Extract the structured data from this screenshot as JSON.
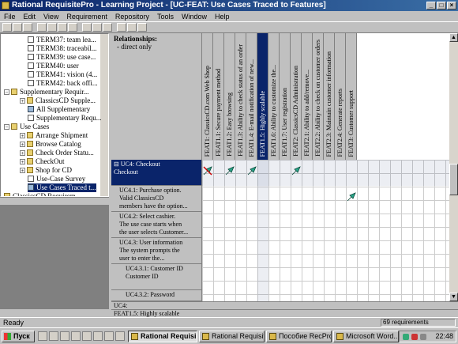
{
  "window": {
    "title": "Rational RequisitePro - Learning Project - [UC-FEAT: Use Cases Traced to Features]",
    "controls": [
      "_",
      "□",
      "×"
    ]
  },
  "menu": [
    "File",
    "Edit",
    "View",
    "Requirement",
    "Repository",
    "Tools",
    "Window",
    "Help"
  ],
  "toolbar": {
    "buttons": [
      "new-icon",
      "open-icon",
      "save-icon",
      "print-icon",
      "cut-icon",
      "copy-icon",
      "paste-icon",
      "undo-icon",
      "properties-icon",
      "query-icon",
      "trace-icon",
      "filter-icon",
      "help-icon"
    ]
  },
  "tree": {
    "items": [
      {
        "label": "TERM37: team lea...",
        "icon": "doc",
        "indent": 34,
        "expander": ""
      },
      {
        "label": "TERM38: traceabil...",
        "icon": "doc",
        "indent": 34,
        "expander": ""
      },
      {
        "label": "TERM39: use case...",
        "icon": "doc",
        "indent": 34,
        "expander": ""
      },
      {
        "label": "TERM40: user",
        "icon": "doc",
        "indent": 34,
        "expander": ""
      },
      {
        "label": "TERM41: vision (4...",
        "icon": "doc",
        "indent": 34,
        "expander": ""
      },
      {
        "label": "TERM42: back offi...",
        "icon": "doc",
        "indent": 34,
        "expander": ""
      },
      {
        "label": "Supplementary Requir...",
        "icon": "folder",
        "indent": 4,
        "expander": "−"
      },
      {
        "label": "ClassicsCD Supple...",
        "icon": "folder",
        "indent": 24,
        "expander": "+"
      },
      {
        "label": "All Supplementary",
        "icon": "pkg",
        "indent": 34,
        "expander": ""
      },
      {
        "label": "Supplementary Requ...",
        "icon": "doc",
        "indent": 34,
        "expander": ""
      },
      {
        "label": "Use Cases",
        "icon": "folder",
        "indent": 4,
        "expander": "−"
      },
      {
        "label": "Arrange Shipment",
        "icon": "folder",
        "indent": 24,
        "expander": "+"
      },
      {
        "label": "Browse Catalog",
        "icon": "folder",
        "indent": 24,
        "expander": "+"
      },
      {
        "label": "Check Order Statu...",
        "icon": "folder",
        "indent": 24,
        "expander": "+"
      },
      {
        "label": "CheckOut",
        "icon": "folder",
        "indent": 24,
        "expander": "+"
      },
      {
        "label": "Shop for CD",
        "icon": "folder",
        "indent": 24,
        "expander": "+"
      },
      {
        "label": "Use-Case Survey",
        "icon": "doc",
        "indent": 34,
        "expander": ""
      },
      {
        "label": "Use Cases Traced t...",
        "icon": "pkg",
        "indent": 34,
        "expander": "",
        "selected": true
      },
      {
        "label": "ClassicsCD Requirem...",
        "icon": "folder",
        "indent": 4,
        "expander": ""
      }
    ]
  },
  "matrix": {
    "corner_title": "Relationships:",
    "corner_sub": "- direct only",
    "columns": [
      {
        "label": "FEAT1: ClassicsCD.com Web Shop"
      },
      {
        "label": "FEAT1.1: Secure payment method"
      },
      {
        "label": "FEAT1.2: Easy browsing"
      },
      {
        "label": "FEAT1.3: Ability to check status of an order"
      },
      {
        "label": "FEAT1.4: E-mail notification of new..."
      },
      {
        "label": "FEAT1.5: Highly scalable",
        "selected": true
      },
      {
        "label": "FEAT1.6: Ability to customize the..."
      },
      {
        "label": "FEAT1.7: User registration"
      },
      {
        "label": "FEAT2: ClassicsCD Administration"
      },
      {
        "label": "FEAT2.1: Ability to add/remove..."
      },
      {
        "label": "FEAT2.2: Ability to check on customer orders"
      },
      {
        "label": "FEAT2.3: Maintain customer information"
      },
      {
        "label": "FEAT2.4: Generate reports"
      },
      {
        "label": "FEAT3: Customer support"
      }
    ],
    "rows": [
      {
        "label": "⊟ UC4: Checkout\nCheckout",
        "height": 33,
        "selected": true
      },
      {
        "label": "UC4.1: Purchase option.\nValid ClassicsCD\nmembers have the option...",
        "height": 33
      },
      {
        "label": "UC4.2: Select cashier.\nThe use case starts when\nthe user selects Customer...",
        "height": 33
      },
      {
        "label": "UC4.3: User information\nThe system prompts the\nuser to enter the...",
        "height": 33
      },
      {
        "label": "UC4.3.1: Customer ID\nCustomer ID",
        "height": 33
      },
      {
        "label": "UC4.3.2: Password",
        "height": 14
      }
    ],
    "traces": [
      {
        "row": 0,
        "col": 0,
        "type": "suspect"
      },
      {
        "row": 0,
        "col": 2,
        "type": "trace"
      },
      {
        "row": 0,
        "col": 4,
        "type": "trace"
      },
      {
        "row": 0,
        "col": 8,
        "type": "trace"
      },
      {
        "row": 1,
        "col": 13,
        "type": "trace"
      }
    ],
    "current_row_label": "UC4:",
    "current_row_text": "FEAT1.5: Highly scalable"
  },
  "status": {
    "ready": "Ready",
    "count": "69 requirements"
  },
  "taskbar": {
    "start": "Пуск",
    "tasks": [
      {
        "label": "Rational Requisi...",
        "active": true
      },
      {
        "label": "Rational Requisite..."
      },
      {
        "label": "Пособие RecPro..."
      },
      {
        "label": "Microsoft Word..."
      }
    ],
    "clock": "22:48"
  },
  "colors": {
    "selection": "#0a246a",
    "trace_arrow": "#2aa58a",
    "panel_gray": "#c0c0c0"
  }
}
